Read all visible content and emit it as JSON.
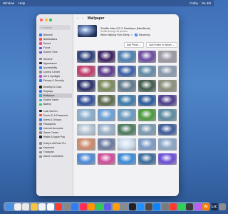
{
  "menubar": {
    "items": [
      "Window",
      "Help"
    ],
    "right": [
      "Cofey",
      "Sa 4/9"
    ]
  },
  "window": {
    "traffic_colors": [
      "#ff5f57",
      "#febc2e",
      "#28c840"
    ],
    "search_placeholder": "Search",
    "title": "Wallpaper",
    "nav_back": "‹",
    "nav_forward": "›"
  },
  "sidebar": {
    "items": [
      {
        "label": "Network",
        "color": "#2f7cf6"
      },
      {
        "label": "Notifications",
        "color": "#f24a4a"
      },
      {
        "label": "Sound",
        "color": "#f24a8a"
      },
      {
        "label": "Focus",
        "color": "#6a4ad8"
      },
      {
        "label": "Screen Time",
        "color": "#6a4ad8"
      },
      {
        "label": "General",
        "color": "#8a8a8f"
      },
      {
        "label": "Appearance",
        "color": "#222222"
      },
      {
        "label": "Accessibility",
        "color": "#2f7cf6"
      },
      {
        "label": "Control Center",
        "color": "#8a8a8f"
      },
      {
        "label": "Siri & Spotlight",
        "color": "#c04ad8"
      },
      {
        "label": "Privacy & Security",
        "color": "#2f7cf6"
      },
      {
        "label": "Desktop & Dock",
        "color": "#222222"
      },
      {
        "label": "Displays",
        "color": "#2f7cf6"
      },
      {
        "label": "Wallpaper",
        "color": "#34aadc"
      },
      {
        "label": "Screen Saver",
        "color": "#34aadc"
      },
      {
        "label": "Battery",
        "color": "#34c759"
      },
      {
        "label": "Lock Screen",
        "color": "#222222"
      },
      {
        "label": "Touch ID & Password",
        "color": "#f24a4a"
      },
      {
        "label": "Users & Groups",
        "color": "#2f7cf6"
      },
      {
        "label": "Passwords",
        "color": "#8a8a8f"
      },
      {
        "label": "Internet Accounts",
        "color": "#2f7cf6"
      },
      {
        "label": "Game Center",
        "color": "#8a8a8f"
      },
      {
        "label": "Wallet & Apple Pay",
        "color": "#222222"
      },
      {
        "label": "Cofey's AirPods Pro",
        "color": "#8a8a8f"
      },
      {
        "label": "Keyboard",
        "color": "#8a8a8f"
      },
      {
        "label": "Trackpad",
        "color": "#8a8a8f"
      },
      {
        "label": "Game Controllers",
        "color": "#8a8a8f"
      }
    ],
    "selected": "Wallpaper"
  },
  "current": {
    "name": "Shuffle Mac OS X Desktops (MacBook)",
    "sub": "Shuffle through 48 pictures",
    "option_label": "When Waking From Sleep",
    "option_arrows": "⇕",
    "randomly_label": "Randomly",
    "randomly_checked": true
  },
  "buttons": {
    "add_photo": "Add Photo ⌄",
    "add_folder": "Add Folder or Album ⌄"
  },
  "wallpapers": [
    [
      "#2a3f7a",
      "#3a2060",
      "#4a7fb0",
      "#6a4aa0",
      "#9e9aa5"
    ],
    [
      "#c23a6a",
      "#5a3a8a",
      "#3a5fa8",
      "#5f8aa8",
      "#8a9ab0"
    ],
    [
      "#2a2f6a",
      "#7a8a5a",
      "#5f7a8a",
      "#3f5a4a",
      "#8a8f7a"
    ],
    [
      "#2f4f9a",
      "#5a6a4a",
      "#3a7aa8",
      "#2a5a9a",
      "#4a3a8a"
    ],
    [
      "#8ab0d0",
      "#6aa0d8",
      "#6a9ac0",
      "#4a9a3a",
      "#5a8aa0"
    ],
    [
      "#b8c8d8",
      "#9ab4cc",
      "#4a7a5a",
      "#7a9ab0",
      "#3a5a9a"
    ],
    [
      "#d08a6a",
      "#6a7aa0",
      "#d0e0f0",
      "#7a9ac8",
      "#8aa8c8"
    ],
    [
      "#4a8ad8",
      "#d04a9a",
      "#3a8ad8",
      "#3a6a9a",
      "#6a4ad8"
    ]
  ],
  "dock": [
    {
      "color": "#4a90e2",
      "label": ""
    },
    {
      "color": "#f0f0f0",
      "label": ""
    },
    {
      "color": "#e8e8e8",
      "label": ""
    },
    {
      "color": "#f4c542",
      "label": ""
    },
    {
      "color": "#f2f2f2",
      "label": ""
    },
    {
      "color": "#ffffff",
      "label": ""
    },
    {
      "color": "#ff3b30",
      "label": ""
    },
    {
      "color": "#888888",
      "label": ""
    },
    {
      "color": "#2f7cf6",
      "label": ""
    },
    {
      "color": "#ff2d55",
      "label": ""
    },
    {
      "color": "#ff9500",
      "label": ""
    },
    {
      "color": "#34c759",
      "label": ""
    },
    {
      "color": "#5e5ce6",
      "label": ""
    },
    {
      "color": "#ff9f0a",
      "label": ""
    },
    {
      "color": "#8a8a8f",
      "label": ""
    },
    {
      "color": "#222222",
      "label": ""
    },
    {
      "color": "#1e90ff",
      "label": ""
    },
    {
      "color": "#4a4a4a",
      "label": ""
    },
    {
      "color": "#0a84ff",
      "label": ""
    },
    {
      "color": "#7a7a7a",
      "label": ""
    },
    {
      "color": "#ff3b30",
      "label": ""
    },
    {
      "color": "#30d158",
      "label": ""
    },
    {
      "color": "#3a3a3a",
      "label": ""
    },
    {
      "color": "#bf5af2",
      "label": ""
    },
    {
      "color": "#ff7a00",
      "label": "Ai"
    },
    {
      "color": "#1c2a4a",
      "label": "Lrc"
    },
    {
      "color": "#8a8a8f",
      "label": ""
    }
  ]
}
